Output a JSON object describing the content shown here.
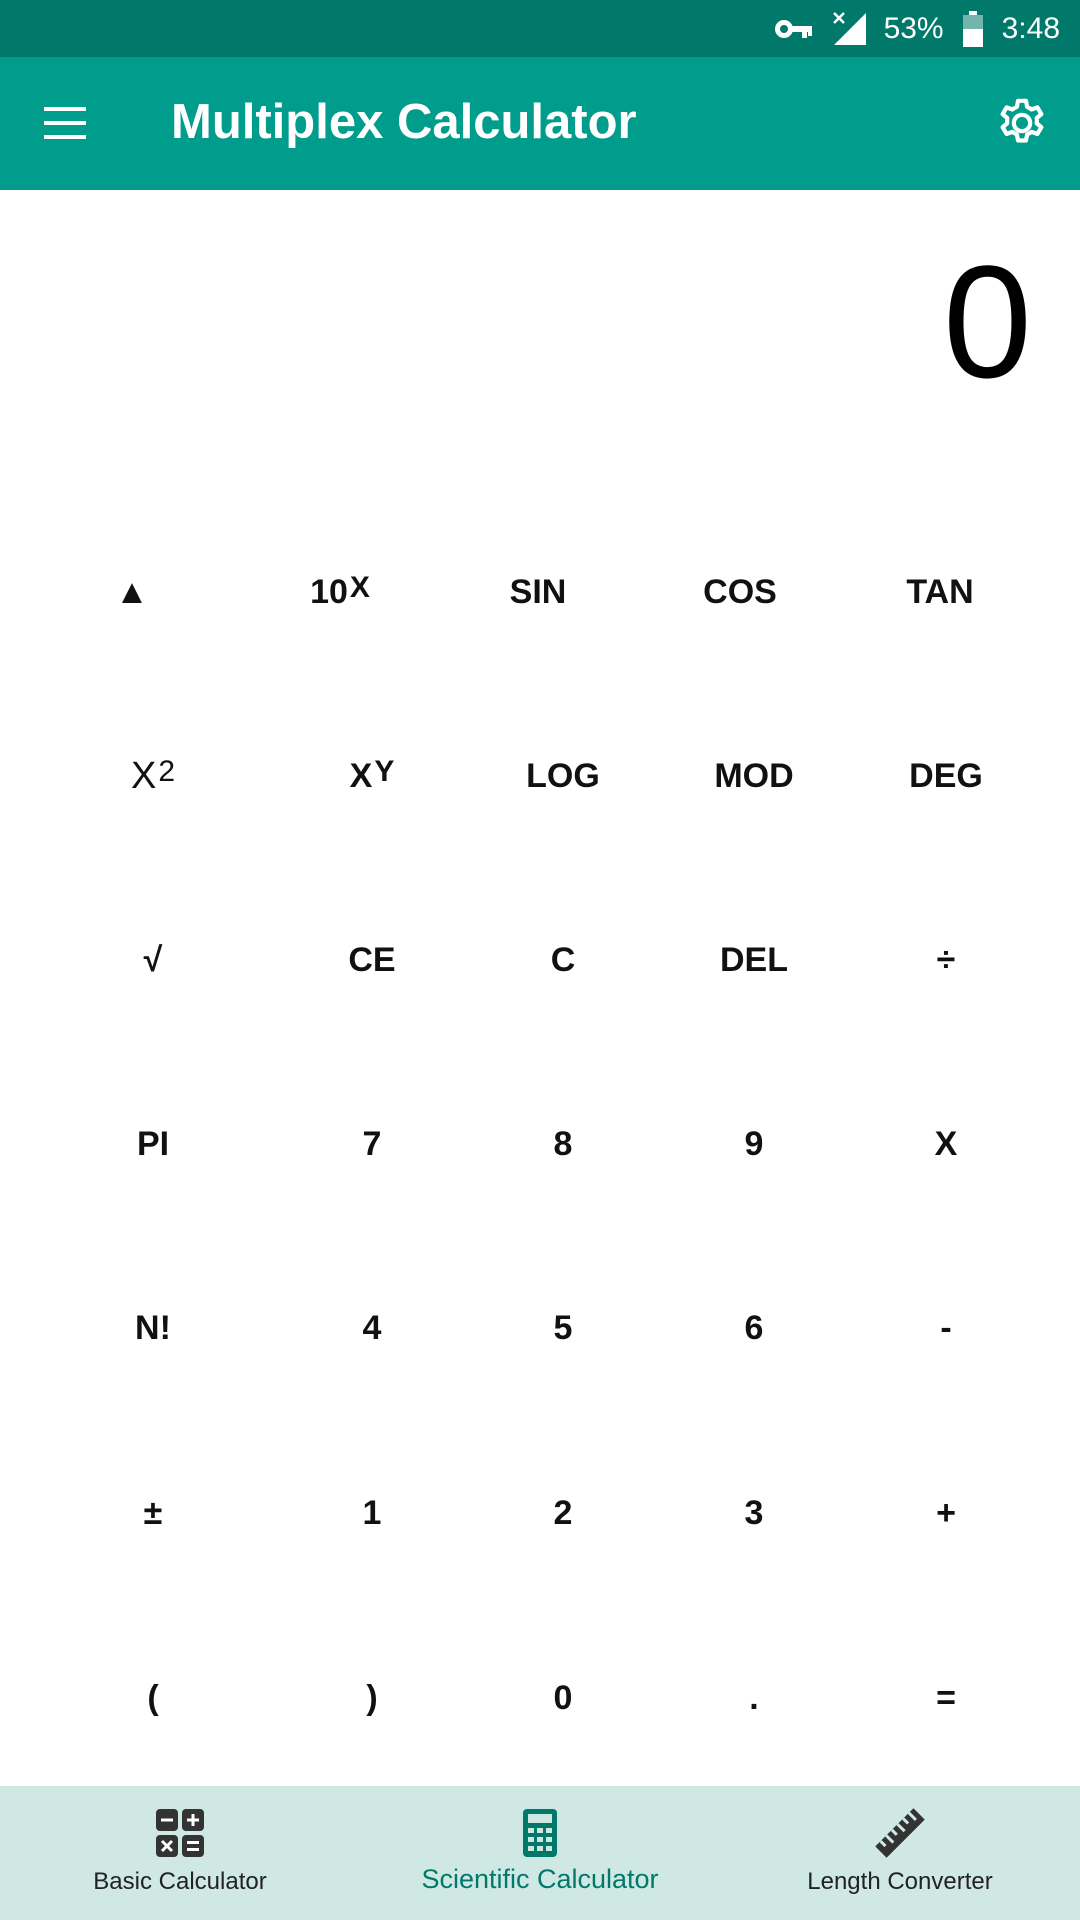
{
  "status_bar": {
    "battery": "53%",
    "time": "3:48",
    "icons": [
      "key-icon",
      "signal-no-data-icon",
      "battery-icon"
    ]
  },
  "app_bar": {
    "title": "Multiplex Calculator",
    "menu_icon": "hamburger-menu-icon",
    "settings_icon": "gear-icon"
  },
  "display": {
    "value": "0"
  },
  "keypad": {
    "row1": [
      {
        "label": "▲"
      },
      {
        "label": "10",
        "sup": "X"
      },
      {
        "label": "SIN"
      },
      {
        "label": "COS"
      },
      {
        "label": "TAN"
      }
    ],
    "row2": [
      {
        "label": "X",
        "sup": "2"
      },
      {
        "label": "X",
        "sup": "Y"
      },
      {
        "label": "LOG"
      },
      {
        "label": "MOD"
      },
      {
        "label": "DEG"
      }
    ],
    "row3": [
      {
        "label": "√"
      },
      {
        "label": "CE"
      },
      {
        "label": "C"
      },
      {
        "label": "DEL"
      },
      {
        "label": "÷"
      }
    ],
    "row4": [
      {
        "label": "PI"
      },
      {
        "label": "7"
      },
      {
        "label": "8"
      },
      {
        "label": "9"
      },
      {
        "label": "X"
      }
    ],
    "row5": [
      {
        "label": "N!"
      },
      {
        "label": "4"
      },
      {
        "label": "5"
      },
      {
        "label": "6"
      },
      {
        "label": "-"
      }
    ],
    "row6": [
      {
        "label": "±"
      },
      {
        "label": "1"
      },
      {
        "label": "2"
      },
      {
        "label": "3"
      },
      {
        "label": "+"
      }
    ],
    "row7": [
      {
        "label": "("
      },
      {
        "label": ")"
      },
      {
        "label": "0"
      },
      {
        "label": "."
      },
      {
        "label": "="
      }
    ]
  },
  "bottom_nav": {
    "items": [
      {
        "label": "Basic Calculator",
        "icon": "basic-operations-icon"
      },
      {
        "label": "Scientific Calculator",
        "icon": "calculator-icon",
        "active": true
      },
      {
        "label": "Length Converter",
        "icon": "ruler-icon"
      }
    ]
  },
  "colors": {
    "status_bar": "#00796B",
    "app_bar": "#009C8C",
    "bottom_nav": "#CFE8E4",
    "accent": "#00796B"
  }
}
